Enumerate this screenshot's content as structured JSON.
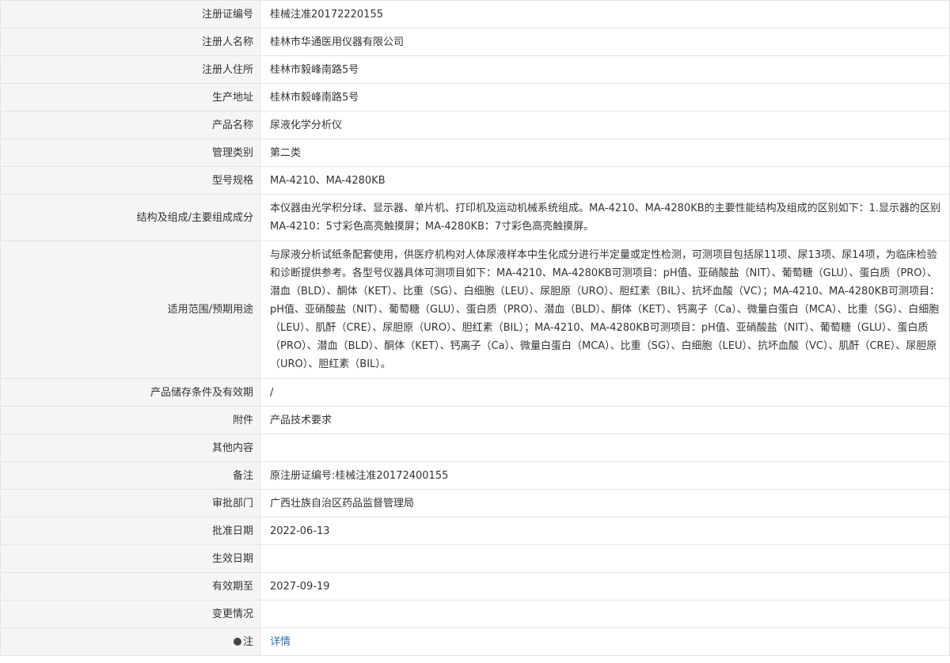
{
  "rows": {
    "reg_no": {
      "label": "注册证编号",
      "value": "桂械注准20172220155"
    },
    "registrant": {
      "label": "注册人名称",
      "value": "桂林市华通医用仪器有限公司"
    },
    "registrant_address": {
      "label": "注册人住所",
      "value": "桂林市毅峰南路5号"
    },
    "production_address": {
      "label": "生产地址",
      "value": "桂林市毅峰南路5号"
    },
    "product_name": {
      "label": "产品名称",
      "value": "尿液化学分析仪"
    },
    "category": {
      "label": "管理类别",
      "value": "第二类"
    },
    "model": {
      "label": "型号规格",
      "value": "MA-4210、MA-4280KB"
    },
    "structure": {
      "label": "结构及组成/主要组成成分",
      "value": "本仪器由光学积分球、显示器、单片机、打印机及运动机械系统组成。MA-4210、MA-4280KB的主要性能结构及组成的区别如下：1.显示器的区别MA-4210：5寸彩色高亮触摸屏；MA-4280KB：7寸彩色高亮触摸屏。"
    },
    "scope": {
      "label": "适用范围/预期用途",
      "value": "与尿液分析试纸条配套使用，供医疗机构对人体尿液样本中生化成分进行半定量或定性检测，可测项目包括尿11项、尿13项、尿14项，为临床检验和诊断提供参考。各型号仪器具体可测项目如下：MA-4210、MA-4280KB可测项目：pH值、亚硝酸盐（NIT）、葡萄糖（GLU）、蛋白质（PRO）、潜血（BLD）、酮体（KET）、比重（SG）、白细胞（LEU）、尿胆原（URO）、胆红素（BIL）、抗坏血酸（VC）；MA-4210、MA-4280KB可测项目：pH值、亚硝酸盐（NIT）、葡萄糖（GLU）、蛋白质（PRO）、潜血（BLD）、酮体（KET）、钙离子（Ca）、微量白蛋白（MCA）、比重（SG）、白细胞（LEU）、肌酐（CRE）、尿胆原（URO）、胆红素（BIL）；MA-4210、MA-4280KB可测项目：pH值、亚硝酸盐（NIT）、葡萄糖（GLU）、蛋白质（PRO）、潜血（BLD）、酮体（KET）、钙离子（Ca）、微量白蛋白（MCA）、比重（SG）、白细胞（LEU）、抗坏血酸（VC）、肌酐（CRE）、尿胆原（URO）、胆红素（BIL）。"
    },
    "storage": {
      "label": "产品储存条件及有效期",
      "value": "/"
    },
    "attachment": {
      "label": "附件",
      "value": "产品技术要求"
    },
    "other": {
      "label": "其他内容",
      "value": ""
    },
    "remark": {
      "label": "备注",
      "value": "原注册证编号:桂械注准20172400155"
    },
    "authority": {
      "label": "审批部门",
      "value": "广西壮族自治区药品监督管理局"
    },
    "approval_date": {
      "label": "批准日期",
      "value": "2022-06-13"
    },
    "effective_date": {
      "label": "生效日期",
      "value": ""
    },
    "valid_until": {
      "label": "有效期至",
      "value": "2027-09-19"
    },
    "changes": {
      "label": "变更情况",
      "value": ""
    },
    "note": {
      "label": "注",
      "value": "详情"
    }
  }
}
